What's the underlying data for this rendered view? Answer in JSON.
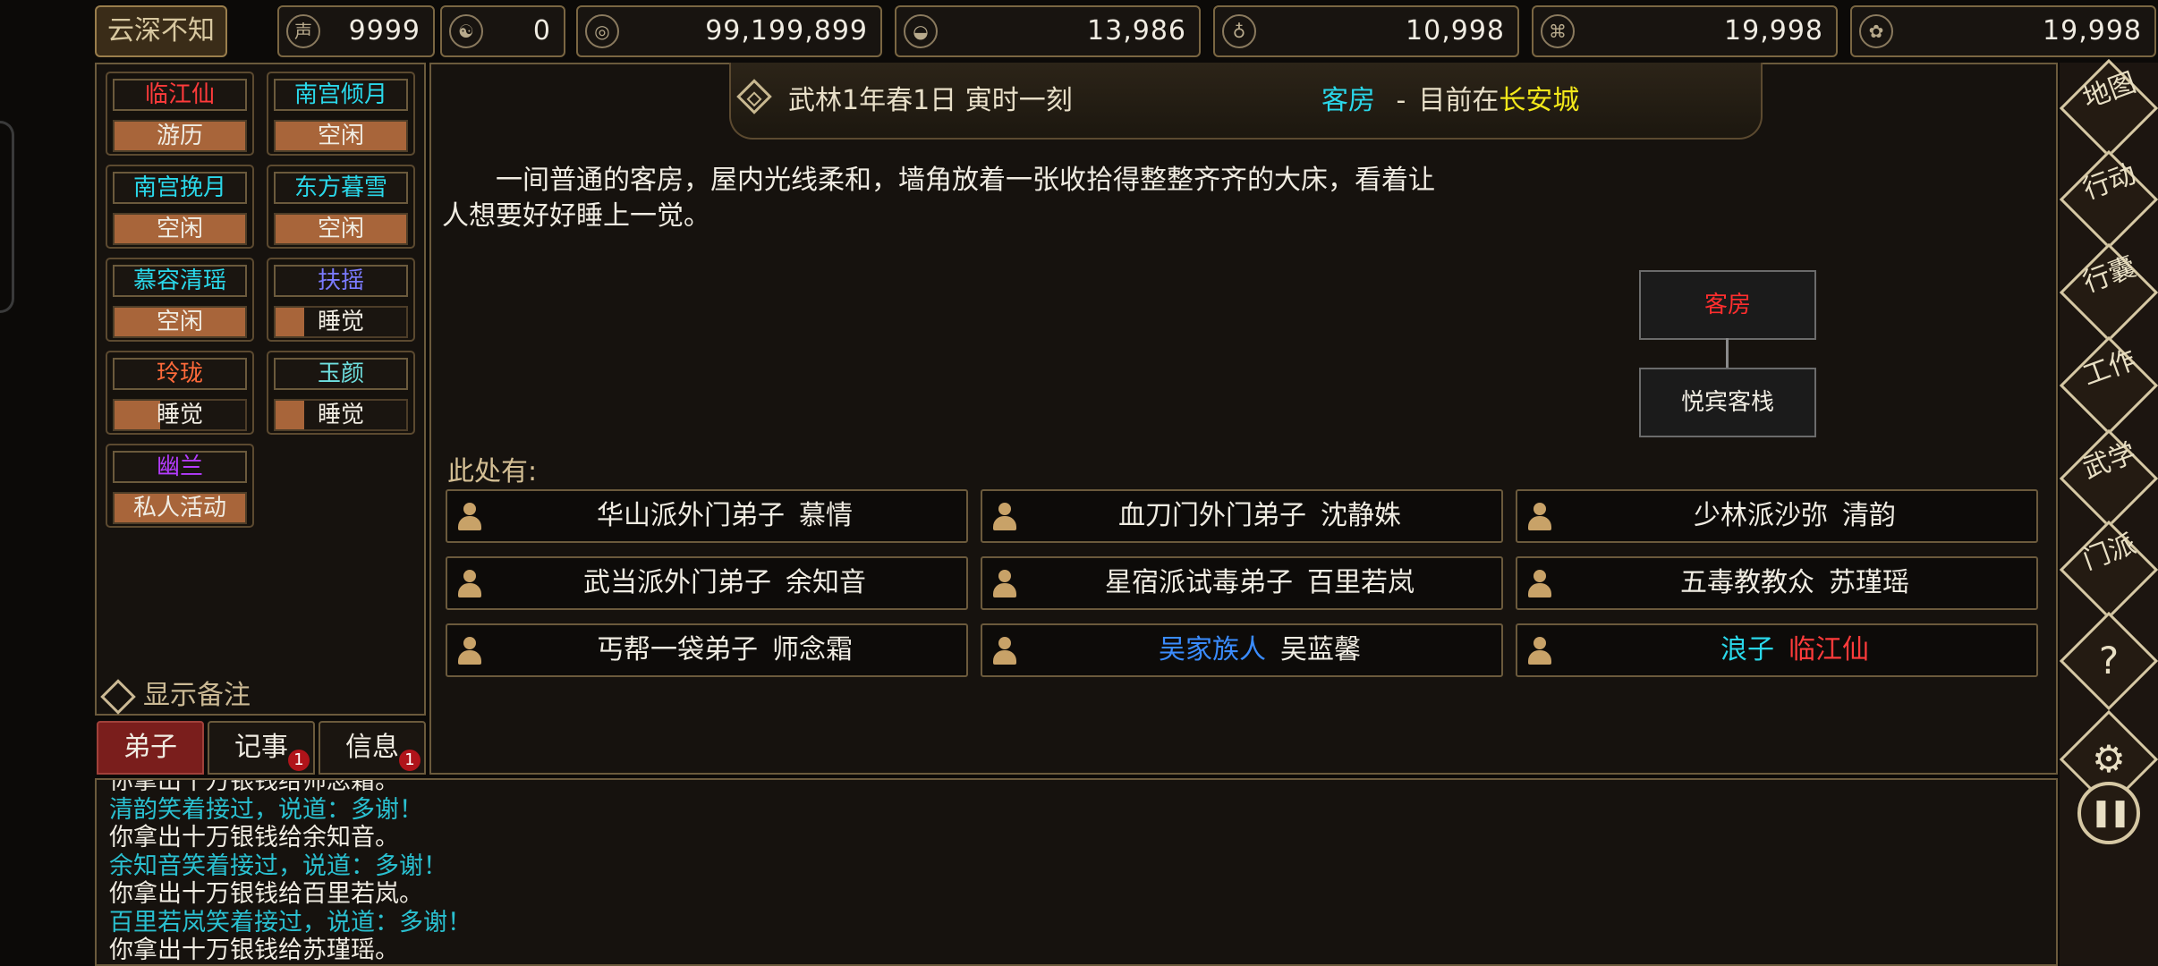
{
  "sect_name": "云深不知梦",
  "resources": [
    {
      "icon": "prestige-icon",
      "glyph": "声",
      "value": "9999"
    },
    {
      "icon": "yinyang-icon",
      "glyph": "☯",
      "value": "0"
    },
    {
      "icon": "coin-icon",
      "glyph": "◎",
      "value": "99,199,899"
    },
    {
      "icon": "food-icon",
      "glyph": "◒",
      "value": "13,986"
    },
    {
      "icon": "medicine-icon",
      "glyph": "♁",
      "value": "10,998"
    },
    {
      "icon": "scroll-icon",
      "glyph": "⌘",
      "value": "19,998"
    },
    {
      "icon": "material-icon",
      "glyph": "✿",
      "value": "19,998"
    }
  ],
  "disciples": [
    {
      "name": "临江仙",
      "name_color": "#ff3b3b",
      "status": "游历",
      "fill": 1.0
    },
    {
      "name": "南宫倾月",
      "name_color": "#2ad8ea",
      "status": "空闲",
      "fill": 1.0
    },
    {
      "name": "南宫挽月",
      "name_color": "#2ad8ea",
      "status": "空闲",
      "fill": 1.0
    },
    {
      "name": "东方暮雪",
      "name_color": "#2ad8ea",
      "status": "空闲",
      "fill": 1.0
    },
    {
      "name": "慕容清瑶",
      "name_color": "#2ad8ea",
      "status": "空闲",
      "fill": 1.0
    },
    {
      "name": "扶摇",
      "name_color": "#7b7bff",
      "status": "睡觉",
      "fill": 0.22
    },
    {
      "name": "玲珑",
      "name_color": "#ff6a3a",
      "status": "睡觉",
      "fill": 0.35
    },
    {
      "name": "玉颜",
      "name_color": "#6fe0e0",
      "status": "睡觉",
      "fill": 0.22
    },
    {
      "name": "幽兰",
      "name_color": "#b43cff",
      "status": "私人活动",
      "fill": 1.0
    }
  ],
  "show_notes_label": "显示备注",
  "tabs": [
    {
      "label": "弟子",
      "badge": ""
    },
    {
      "label": "记事",
      "badge": "1"
    },
    {
      "label": "信息",
      "badge": "1"
    }
  ],
  "scene": {
    "time": "武林1年春1日 寅时一刻",
    "room": "客房",
    "dash": "-",
    "at_prefix": "目前在",
    "city": "长安城",
    "description": "一间普通的客房，屋内光线柔和，墙角放着一张收拾得整整齐齐的大床，看着让人想要好好睡上一觉。",
    "map_current": "客房",
    "map_parent": "悦宾客栈",
    "here_label": "此处有:"
  },
  "npcs": [
    {
      "title": "华山派外门弟子",
      "title_color": "#f0ece2",
      "name": "慕情",
      "name_color": "#f0ece2"
    },
    {
      "title": "血刀门外门弟子",
      "title_color": "#f0ece2",
      "name": "沈静姝",
      "name_color": "#f0ece2"
    },
    {
      "title": "少林派沙弥",
      "title_color": "#f0ece2",
      "name": "清韵",
      "name_color": "#f0ece2"
    },
    {
      "title": "武当派外门弟子",
      "title_color": "#f0ece2",
      "name": "余知音",
      "name_color": "#f0ece2"
    },
    {
      "title": "星宿派试毒弟子",
      "title_color": "#f0ece2",
      "name": "百里若岚",
      "name_color": "#f0ece2"
    },
    {
      "title": "五毒教教众",
      "title_color": "#f0ece2",
      "name": "苏瑾瑶",
      "name_color": "#f0ece2"
    },
    {
      "title": "丐帮一袋弟子",
      "title_color": "#f0ece2",
      "name": "师念霜",
      "name_color": "#f0ece2"
    },
    {
      "title": "吴家族人",
      "title_color": "#3a8cff",
      "name": "吴蓝馨",
      "name_color": "#f0ece2"
    },
    {
      "title": "浪子",
      "title_color": "#2ad8ea",
      "name": "临江仙",
      "name_color": "#ff3b3b"
    }
  ],
  "log": [
    {
      "text": "你拿出十万银钱给师念霜。",
      "color": "#f0ece2"
    },
    {
      "text": "清韵笑着接过，说道：多谢！",
      "color": "#2ac0d0"
    },
    {
      "text": "你拿出十万银钱给余知音。",
      "color": "#f0ece2"
    },
    {
      "text": "余知音笑着接过，说道：多谢！",
      "color": "#2ac0d0"
    },
    {
      "text": "你拿出十万银钱给百里若岚。",
      "color": "#f0ece2"
    },
    {
      "text": "百里若岚笑着接过，说道：多谢！",
      "color": "#2ac0d0"
    },
    {
      "text": "你拿出十万银钱给苏瑾瑶。",
      "color": "#f0ece2"
    }
  ],
  "right_menu": [
    "地图",
    "行动",
    "行囊",
    "工作",
    "武学",
    "门派"
  ],
  "right_icons": [
    "help-icon",
    "settings-icon",
    "pause-icon"
  ],
  "help_glyph": "?",
  "settings_glyph": "⚙",
  "pause_glyph": "❚❚"
}
